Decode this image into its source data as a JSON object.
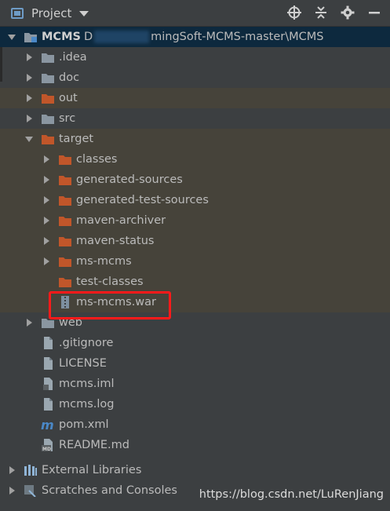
{
  "toolbar": {
    "title": "Project",
    "icons": [
      "project-icon",
      "caret-down-icon",
      "locate-icon",
      "collapse-all-icon",
      "gear-icon",
      "hide-icon"
    ]
  },
  "tree": {
    "root_name": "MCMS",
    "root_path": "mingSoft-MCMS-master\\MCMS",
    "root_path_prefix": "D",
    "items": [
      {
        "label": ".idea",
        "icon": "folder"
      },
      {
        "label": "doc",
        "icon": "folder"
      },
      {
        "label": "out",
        "icon": "folder-orange"
      },
      {
        "label": "src",
        "icon": "folder"
      },
      {
        "label": "target",
        "icon": "folder-orange"
      },
      {
        "label": "classes",
        "icon": "folder-orange"
      },
      {
        "label": "generated-sources",
        "icon": "folder-orange"
      },
      {
        "label": "generated-test-sources",
        "icon": "folder-orange"
      },
      {
        "label": "maven-archiver",
        "icon": "folder-orange"
      },
      {
        "label": "maven-status",
        "icon": "folder-orange"
      },
      {
        "label": "ms-mcms",
        "icon": "folder-orange"
      },
      {
        "label": "test-classes",
        "icon": "folder-orange"
      },
      {
        "label": "ms-mcms.war",
        "icon": "war-archive-icon"
      },
      {
        "label": "web",
        "icon": "folder"
      },
      {
        "label": ".gitignore",
        "icon": "file-icon"
      },
      {
        "label": "LICENSE",
        "icon": "file-icon"
      },
      {
        "label": "mcms.iml",
        "icon": "module-file-icon"
      },
      {
        "label": "mcms.log",
        "icon": "file-icon"
      },
      {
        "label": "pom.xml",
        "icon": "maven-icon"
      },
      {
        "label": "README.md",
        "icon": "markdown-icon"
      }
    ],
    "external_libraries": "External Libraries",
    "scratches": "Scratches and Consoles"
  },
  "watermark": "https://blog.csdn.net/LuRenJiang",
  "colors": {
    "background": "#3c3f41",
    "selection": "#0d293e",
    "excluded_row": "#46433a",
    "folder_gray": "#8a96a1",
    "folder_orange": "#c1562a",
    "highlight_box": "#ff1a1a"
  }
}
